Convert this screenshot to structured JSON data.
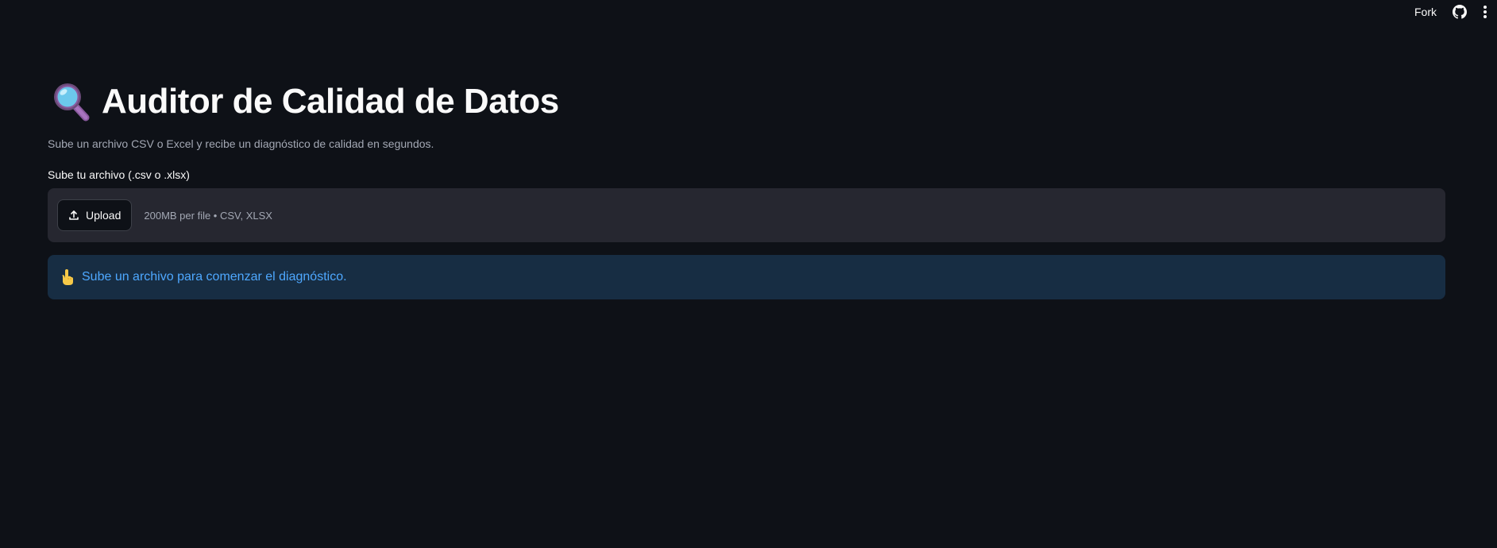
{
  "header": {
    "fork_label": "Fork",
    "github_icon": "github-icon",
    "menu_icon": "more-vertical-icon"
  },
  "main": {
    "title_icon": "magnifying-glass-icon",
    "title": "Auditor de Calidad de Datos",
    "subtitle": "Sube un archivo CSV o Excel y recibe un diagnóstico de calidad en segundos.",
    "uploader": {
      "label": "Sube tu archivo (.csv o .xlsx)",
      "button_label": "Upload",
      "button_icon": "upload-icon",
      "hint": "200MB per file • CSV, XLSX"
    },
    "info": {
      "icon": "pointing-hand-icon",
      "message": "Sube un archivo para comenzar el diagnóstico."
    }
  },
  "colors": {
    "background": "#0e1117",
    "dropzone": "#262730",
    "info_background": "#172d43",
    "info_text": "#4ea8ff",
    "muted_text": "#a3a8b4"
  }
}
